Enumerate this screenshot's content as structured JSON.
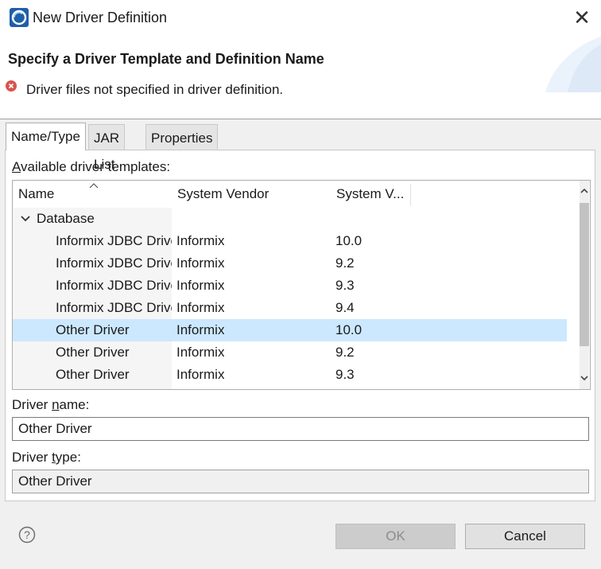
{
  "window": {
    "title": "New Driver Definition",
    "close_symbol": "✕"
  },
  "header": {
    "title": "Specify a Driver Template and Definition Name",
    "error_message": "Driver files not specified in driver definition."
  },
  "tabs": [
    {
      "label": "Name/Type",
      "active": true
    },
    {
      "label": "JAR List",
      "active": false
    },
    {
      "label": "Properties",
      "active": false
    }
  ],
  "templates": {
    "label_access": "A",
    "label_rest": "vailable driver templates:",
    "columns": [
      "Name",
      "System Vendor",
      "System V..."
    ],
    "group": "Database",
    "rows": [
      {
        "name": "Informix JDBC Driver",
        "vendor": "Informix",
        "version": "10.0"
      },
      {
        "name": "Informix JDBC Driver",
        "vendor": "Informix",
        "version": "9.2"
      },
      {
        "name": "Informix JDBC Driver",
        "vendor": "Informix",
        "version": "9.3"
      },
      {
        "name": "Informix JDBC Driver",
        "vendor": "Informix",
        "version": "9.4"
      },
      {
        "name": "Other Driver",
        "vendor": "Informix",
        "version": "10.0",
        "selected": true
      },
      {
        "name": "Other Driver",
        "vendor": "Informix",
        "version": "9.2"
      },
      {
        "name": "Other Driver",
        "vendor": "Informix",
        "version": "9.3"
      }
    ]
  },
  "driver_name": {
    "label_pre": "Driver ",
    "label_access": "n",
    "label_post": "ame:",
    "value": "Other Driver"
  },
  "driver_type": {
    "label_pre": "Driver ",
    "label_access": "t",
    "label_post": "ype:",
    "value": "Other Driver"
  },
  "buttons": {
    "ok": "OK",
    "cancel": "Cancel"
  },
  "colors": {
    "selection": "#cce8ff",
    "error": "#d9534f",
    "accent": "#1f6fbf"
  }
}
